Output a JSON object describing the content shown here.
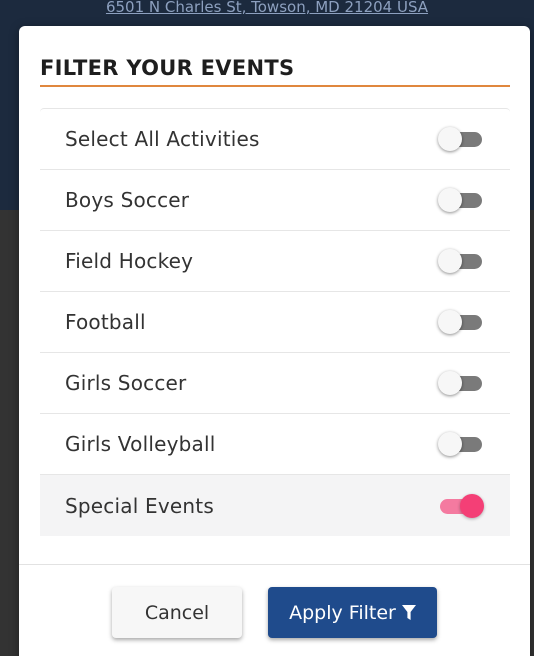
{
  "background": {
    "address_text": "6501 N Charles St, Towson, MD 21204 USA"
  },
  "modal": {
    "title": "FILTER YOUR EVENTS",
    "accent_color": "#e0873e",
    "items": [
      {
        "label": "Select All Activities",
        "enabled": false
      },
      {
        "label": "Boys Soccer",
        "enabled": false
      },
      {
        "label": "Field Hockey",
        "enabled": false
      },
      {
        "label": "Football",
        "enabled": false
      },
      {
        "label": "Girls Soccer",
        "enabled": false
      },
      {
        "label": "Girls Volleyball",
        "enabled": false
      },
      {
        "label": "Special Events",
        "enabled": true
      }
    ],
    "toggle_on_color": "#f43f76",
    "toggle_off_color": "#7a7a7a"
  },
  "footer": {
    "cancel_label": "Cancel",
    "apply_label": "Apply Filter",
    "apply_icon": "filter-icon",
    "apply_color": "#1f4b8c"
  }
}
